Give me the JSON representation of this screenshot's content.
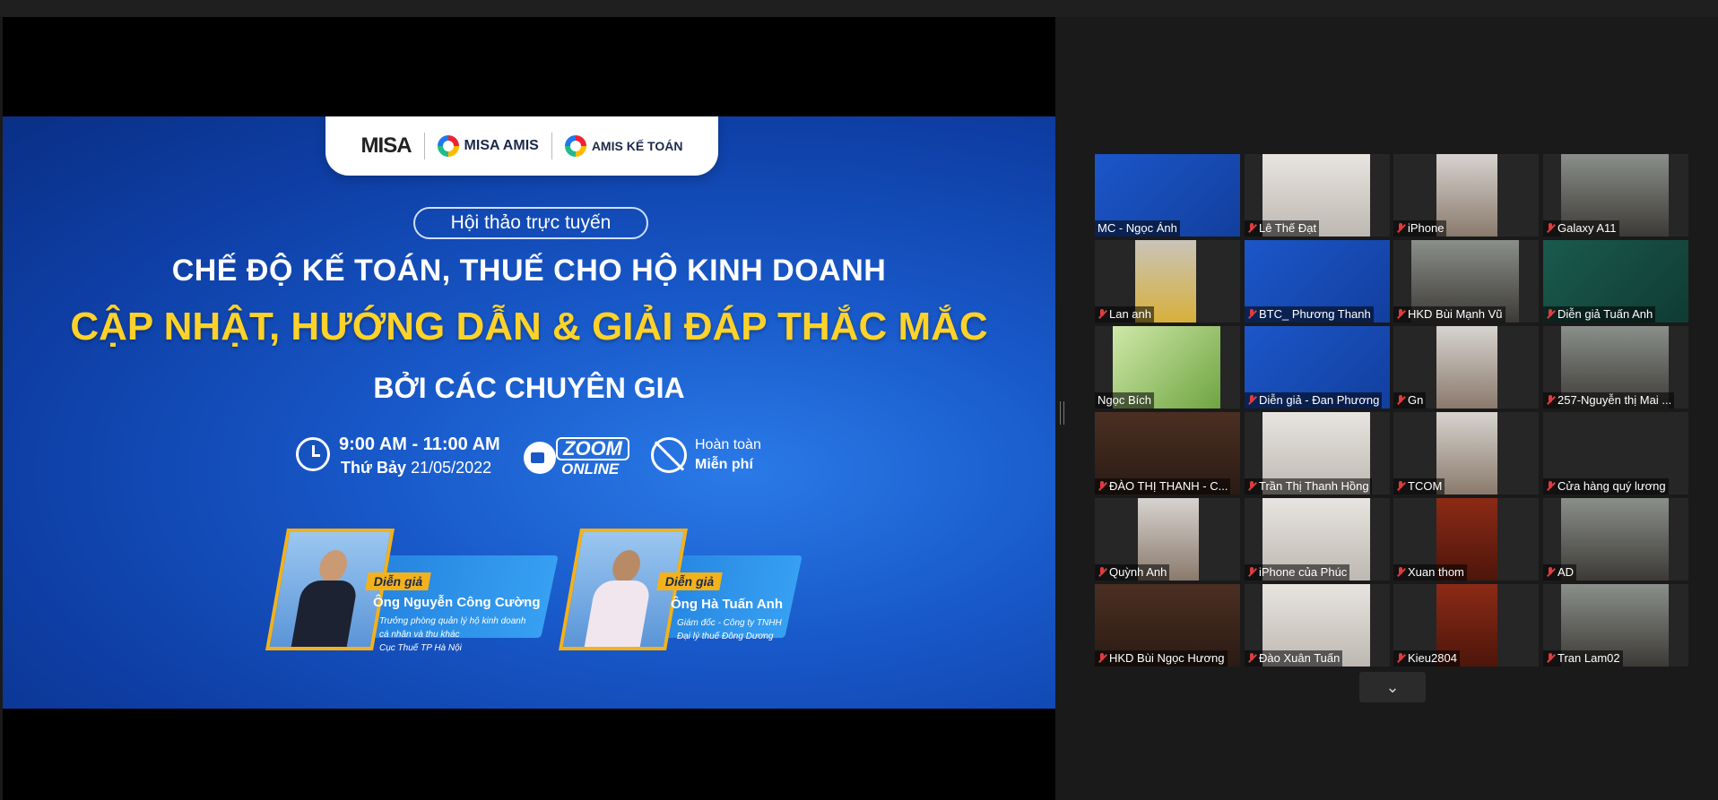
{
  "slide": {
    "logos": {
      "misa": "MISA",
      "amis": "MISA AMIS",
      "ketoan": "AMIS KẾ TOÁN"
    },
    "badge": "Hội thảo trực tuyến",
    "title_line1": "CHẾ ĐỘ KẾ TOÁN, THUẾ CHO HỘ KINH DOANH",
    "title_line2": "CẬP NHẬT, HƯỚNG DẪN & GIẢI ĐÁP THẮC MẮC",
    "title_line3": "BỞI CÁC CHUYÊN GIA",
    "time": "9:00 AM - 11:00 AM",
    "date_day": "Thứ Bảy",
    "date": "21/05/2022",
    "zoom": "ZOOM",
    "zoom_sub": "ONLINE",
    "free_line1": "Hoàn toàn",
    "free_line2": "Miễn phí",
    "speakers": [
      {
        "tag": "Diễn giả",
        "name": "Ông Nguyễn Công Cường",
        "desc1": "Trưởng phòng quản lý hộ kinh doanh",
        "desc2": "cá nhân và thu khác",
        "desc3": "Cục Thuế TP Hà Nội"
      },
      {
        "tag": "Diễn giả",
        "name": "Ông Hà Tuấn Anh",
        "desc1": "Giám đốc - Công ty TNHH",
        "desc2": "Đại lý thuế Đông Dương",
        "desc3": ""
      }
    ]
  },
  "participants": [
    {
      "name": "MC - Ngọc Ánh",
      "muted": false,
      "active": true,
      "video": "slide"
    },
    {
      "name": "Lê Thế Đạt",
      "muted": true,
      "video": "room-light"
    },
    {
      "name": "iPhone",
      "muted": true,
      "video": "room"
    },
    {
      "name": "Galaxy A11",
      "muted": true,
      "video": "person"
    },
    {
      "name": "Lan anh",
      "muted": true,
      "video": "person-yellow"
    },
    {
      "name": "BTC_ Phương Thanh",
      "muted": true,
      "video": "slide"
    },
    {
      "name": "HKD Bùi Mạnh Vũ",
      "muted": true,
      "video": "person"
    },
    {
      "name": "Diễn giả Tuấn Anh",
      "muted": true,
      "video": "green-slide"
    },
    {
      "name": "Ngọc Bích",
      "muted": false,
      "video": "plants"
    },
    {
      "name": "Diễn giả - Đan Phương",
      "muted": true,
      "video": "slide"
    },
    {
      "name": "Gn",
      "muted": true,
      "video": "room"
    },
    {
      "name": "257-Nguyễn thị Mai ...",
      "muted": true,
      "video": "person"
    },
    {
      "name": "ĐÀO THỊ THANH - C...",
      "muted": true,
      "video": "shelf"
    },
    {
      "name": "Trần Thị Thanh Hồng",
      "muted": true,
      "video": "room-light"
    },
    {
      "name": "TCOM",
      "muted": true,
      "video": "room"
    },
    {
      "name": "Cửa hàng quý lương",
      "muted": true,
      "video": "none"
    },
    {
      "name": "Quỳnh Anh",
      "muted": true,
      "video": "room"
    },
    {
      "name": "iPhone của Phúc",
      "muted": true,
      "video": "room-light"
    },
    {
      "name": "Xuan thom",
      "muted": true,
      "video": "red"
    },
    {
      "name": "AD",
      "muted": true,
      "video": "person"
    },
    {
      "name": "HKD Bùi Ngọc Hương",
      "muted": true,
      "video": "shelf"
    },
    {
      "name": "Đào Xuân Tuấn",
      "muted": true,
      "video": "room-light"
    },
    {
      "name": "Kieu2804",
      "muted": true,
      "video": "red"
    },
    {
      "name": "Tran Lam02",
      "muted": true,
      "video": "person"
    }
  ],
  "pager": {
    "next_icon": "chevron-down-icon",
    "glyph": "⌄"
  }
}
